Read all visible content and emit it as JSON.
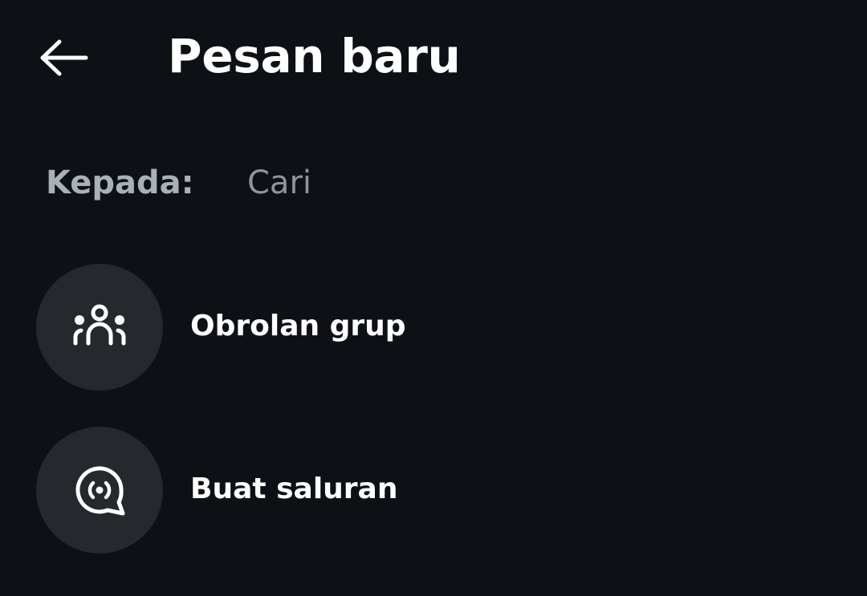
{
  "header": {
    "back_icon": "arrow-left-icon",
    "title": "Pesan baru"
  },
  "recipient": {
    "label": "Kepada:",
    "search_placeholder": "Cari",
    "search_value": ""
  },
  "actions": [
    {
      "label": "Obrolan grup",
      "icon": "group-people-icon"
    },
    {
      "label": "Buat saluran",
      "icon": "broadcast-channel-icon"
    }
  ],
  "colors": {
    "background": "#0d1014",
    "icon_circle": "#25282c",
    "text_primary": "#ffffff",
    "text_secondary": "#aab0b8",
    "placeholder": "#8e949c"
  }
}
